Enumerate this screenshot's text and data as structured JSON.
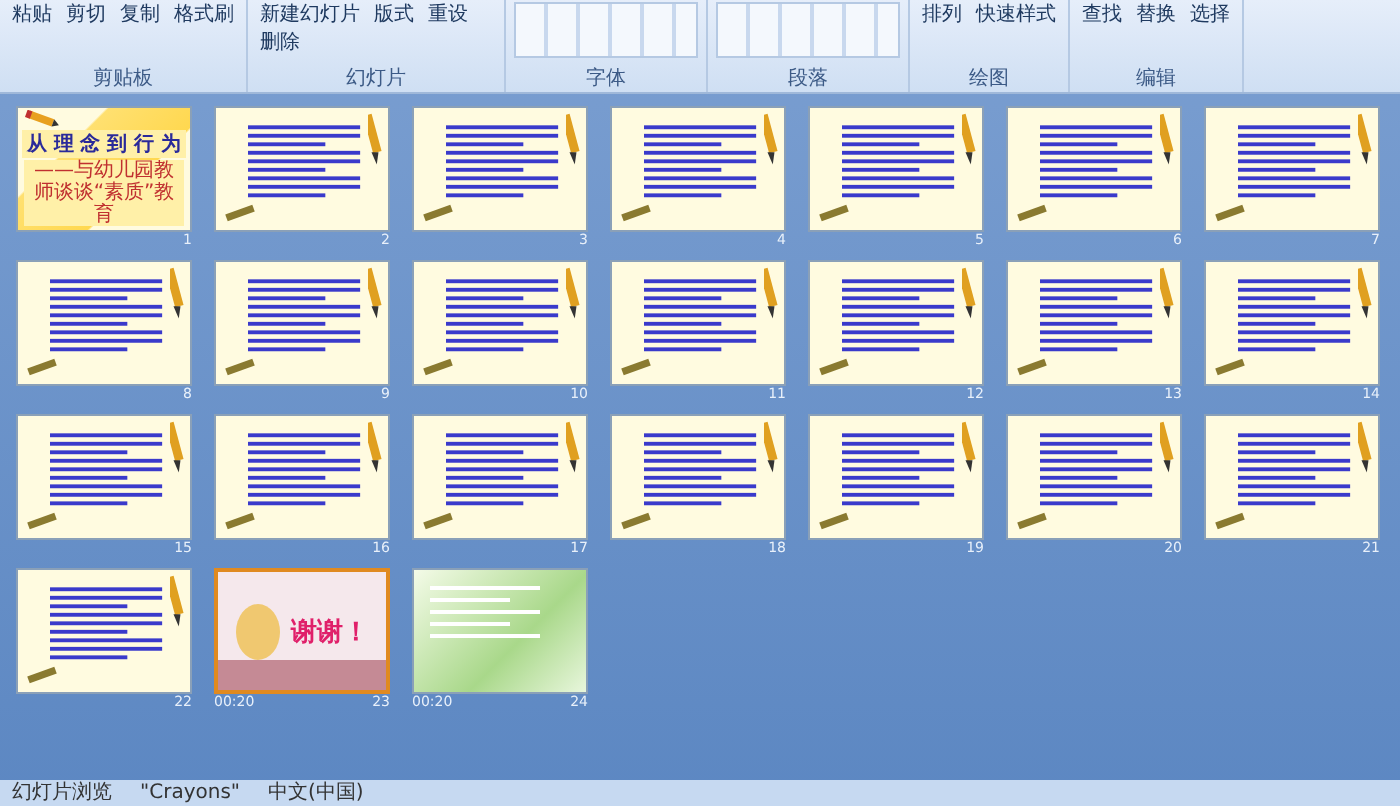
{
  "ribbon": {
    "groups": [
      {
        "label": "剪贴板",
        "buttons": [
          "粘贴",
          "剪切",
          "复制",
          "格式刷"
        ]
      },
      {
        "label": "幻灯片",
        "buttons": [
          "新建幻灯片",
          "版式",
          "重设",
          "删除"
        ]
      },
      {
        "label": "字体"
      },
      {
        "label": "段落"
      },
      {
        "label": "绘图",
        "buttons": [
          "排列",
          "快速样式"
        ]
      },
      {
        "label": "编辑",
        "buttons": [
          "查找",
          "替换",
          "选择"
        ]
      }
    ]
  },
  "slides": [
    {
      "number": "1",
      "kind": "title",
      "selected": false,
      "title": "从 理 念 到 行 为",
      "subtitle": "——与幼儿园教师谈谈“素质”教育"
    },
    {
      "number": "2",
      "kind": "text",
      "selected": false
    },
    {
      "number": "3",
      "kind": "text",
      "selected": false
    },
    {
      "number": "4",
      "kind": "text",
      "selected": false
    },
    {
      "number": "5",
      "kind": "text",
      "selected": false
    },
    {
      "number": "6",
      "kind": "text",
      "selected": false
    },
    {
      "number": "7",
      "kind": "text",
      "selected": false
    },
    {
      "number": "8",
      "kind": "text",
      "selected": false
    },
    {
      "number": "9",
      "kind": "text",
      "selected": false
    },
    {
      "number": "10",
      "kind": "text",
      "selected": false
    },
    {
      "number": "11",
      "kind": "text",
      "selected": false
    },
    {
      "number": "12",
      "kind": "text",
      "selected": false
    },
    {
      "number": "13",
      "kind": "text",
      "selected": false
    },
    {
      "number": "14",
      "kind": "text",
      "selected": false
    },
    {
      "number": "15",
      "kind": "text",
      "selected": false
    },
    {
      "number": "16",
      "kind": "text",
      "selected": false
    },
    {
      "number": "17",
      "kind": "text",
      "selected": false
    },
    {
      "number": "18",
      "kind": "text",
      "selected": false
    },
    {
      "number": "19",
      "kind": "text",
      "selected": false
    },
    {
      "number": "20",
      "kind": "text",
      "selected": false
    },
    {
      "number": "21",
      "kind": "text",
      "selected": false
    },
    {
      "number": "22",
      "kind": "text",
      "selected": false
    },
    {
      "number": "23",
      "kind": "thanks",
      "selected": true,
      "timing": "00:20",
      "title": "谢谢！"
    },
    {
      "number": "24",
      "kind": "green",
      "selected": false,
      "timing": "00:20"
    }
  ],
  "status_bar": {
    "view": "幻灯片浏览",
    "theme": "\"Crayons\"",
    "language": "中文(中国)"
  }
}
